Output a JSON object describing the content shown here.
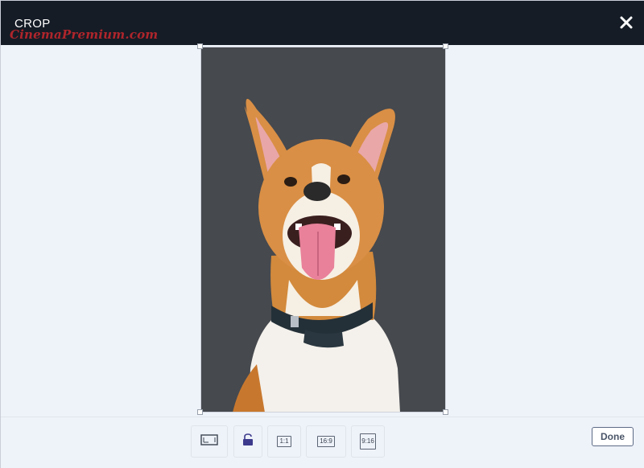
{
  "header": {
    "title": "CROP",
    "watermark": "CinemaPremium.com"
  },
  "crop": {
    "image_description": "dog photo"
  },
  "toolbar": {
    "tools": [
      {
        "name": "free-crop",
        "icon": "free-crop-icon"
      },
      {
        "name": "lock-aspect",
        "icon": "lock-icon"
      },
      {
        "name": "ratio-1-1",
        "label": "1:1"
      },
      {
        "name": "ratio-16-9",
        "label": "16:9"
      },
      {
        "name": "ratio-9-16",
        "label": "9:16"
      }
    ],
    "done_label": "Done"
  },
  "colors": {
    "header_bg": "#151c26",
    "canvas_bg": "#eef2f9",
    "photo_bg": "#46494e",
    "lock_accent": "#3b3a8c"
  }
}
